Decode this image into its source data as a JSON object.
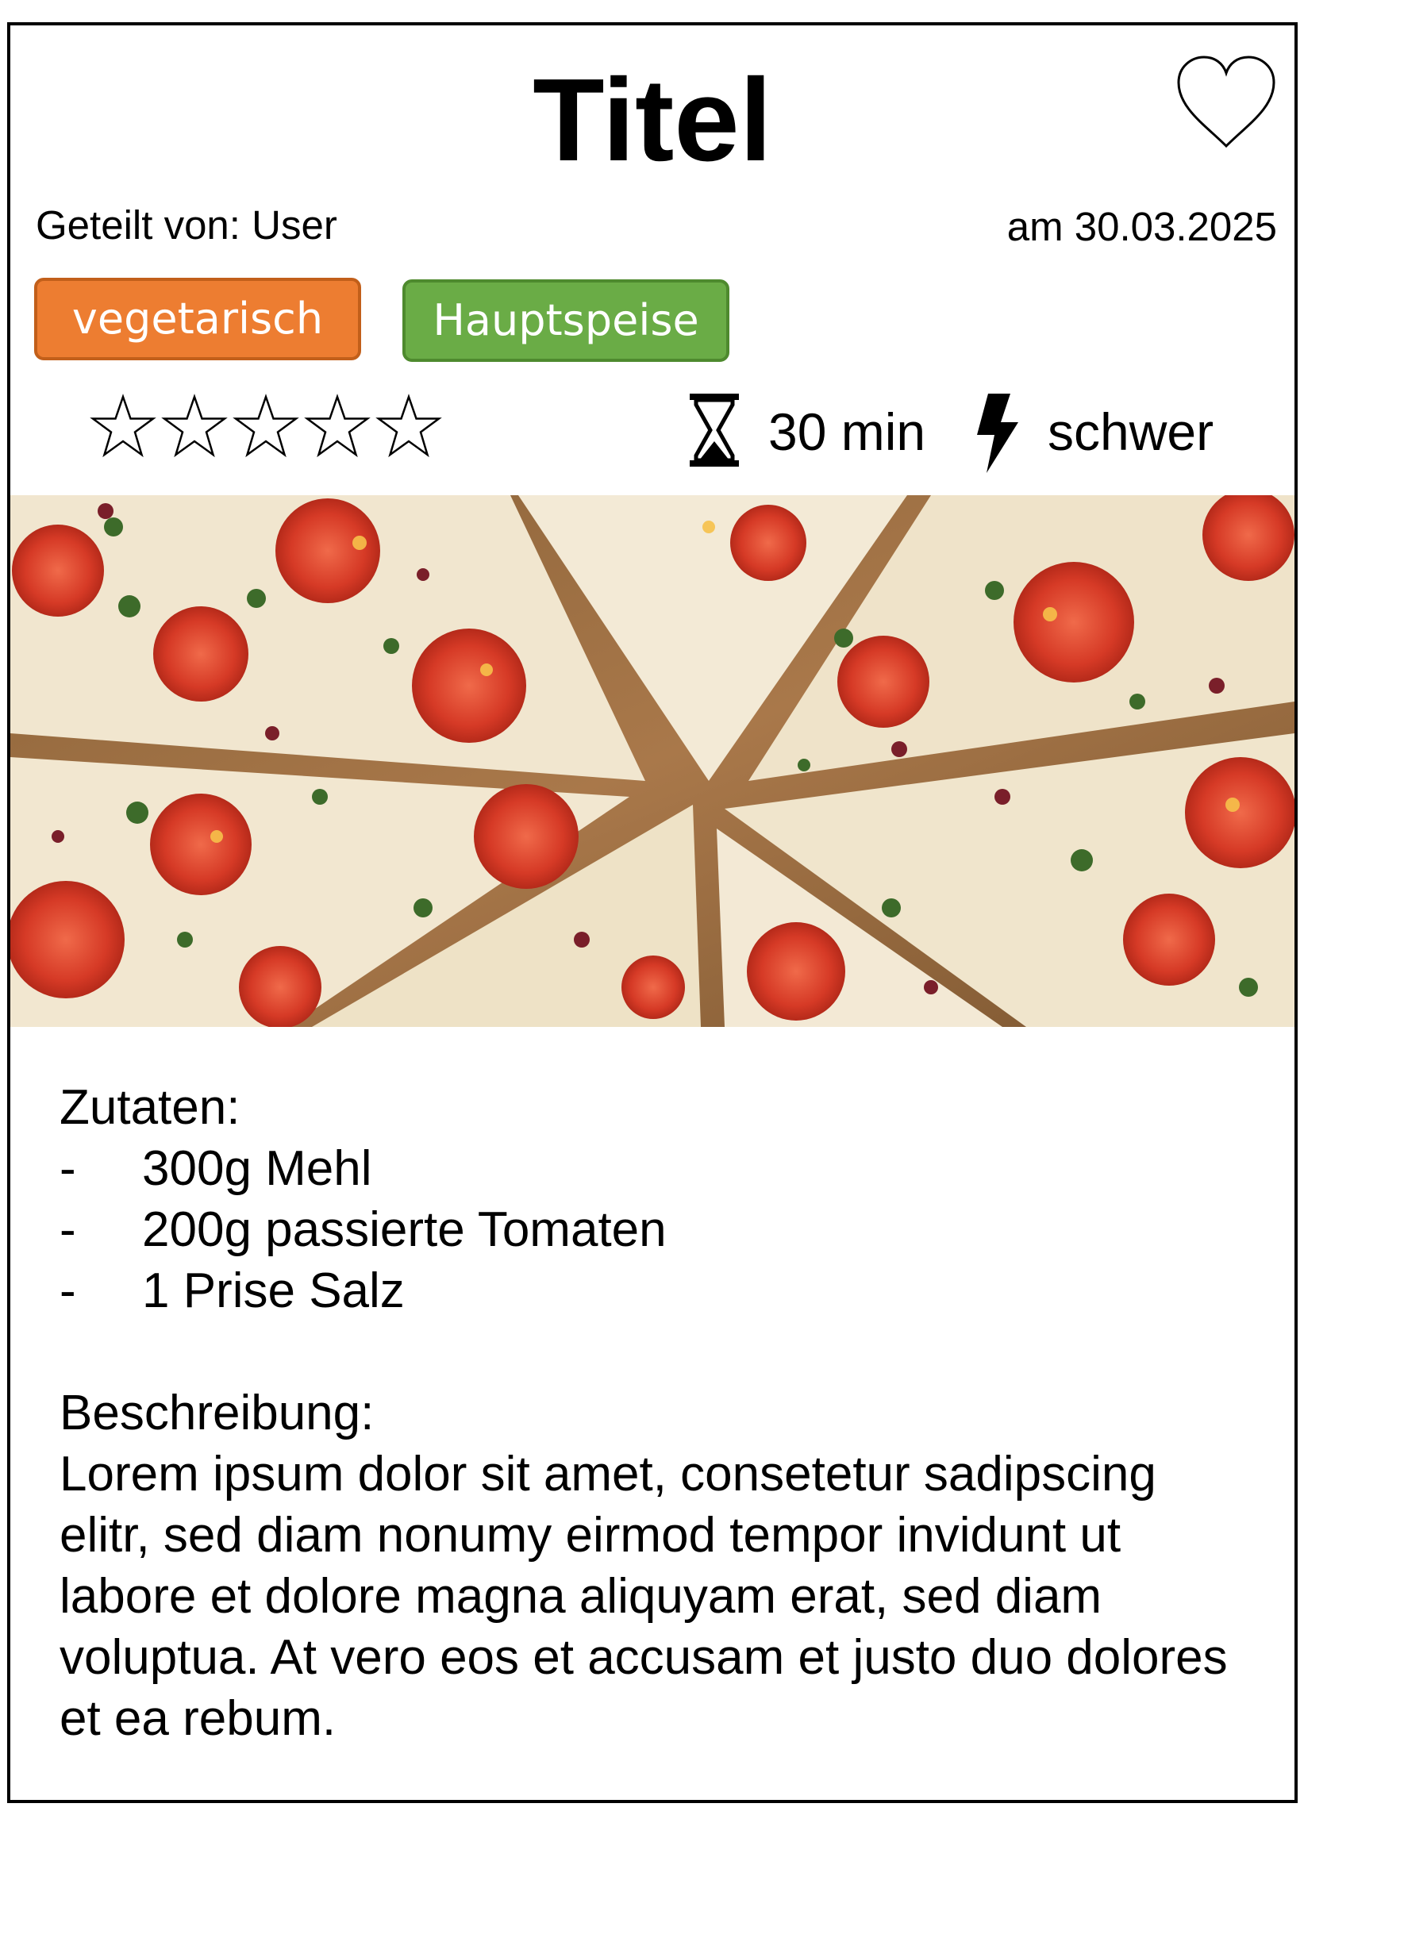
{
  "header": {
    "title": "Titel",
    "favorite_icon": "heart-outline-icon"
  },
  "meta": {
    "shared_by": "Geteilt von: User",
    "date": "am 30.03.2025"
  },
  "tags": [
    {
      "label": "vegetarisch",
      "color": "#ed7d31"
    },
    {
      "label": "Hauptspeise",
      "color": "#6aac46"
    }
  ],
  "rating": {
    "stars_total": 5,
    "stars_filled": 0,
    "icon": "star-outline-icon"
  },
  "stats": {
    "time_icon": "hourglass-icon",
    "time": "30 min",
    "difficulty_icon": "lightning-bolt-icon",
    "difficulty": "schwer"
  },
  "image": {
    "subject": "pizza-photo"
  },
  "ingredients": {
    "heading": "Zutaten:",
    "bullet": "-",
    "items": [
      "300g Mehl",
      "200g passierte Tomaten",
      "1 Prise Salz"
    ]
  },
  "description": {
    "heading": "Beschreibung:",
    "text": "Lorem ipsum dolor sit amet, consetetur sadipscing elitr, sed diam nonumy eirmod tempor invidunt ut labore et dolore magna aliquyam erat, sed diam voluptua. At vero eos et accusam et justo duo dolores et ea rebum."
  }
}
